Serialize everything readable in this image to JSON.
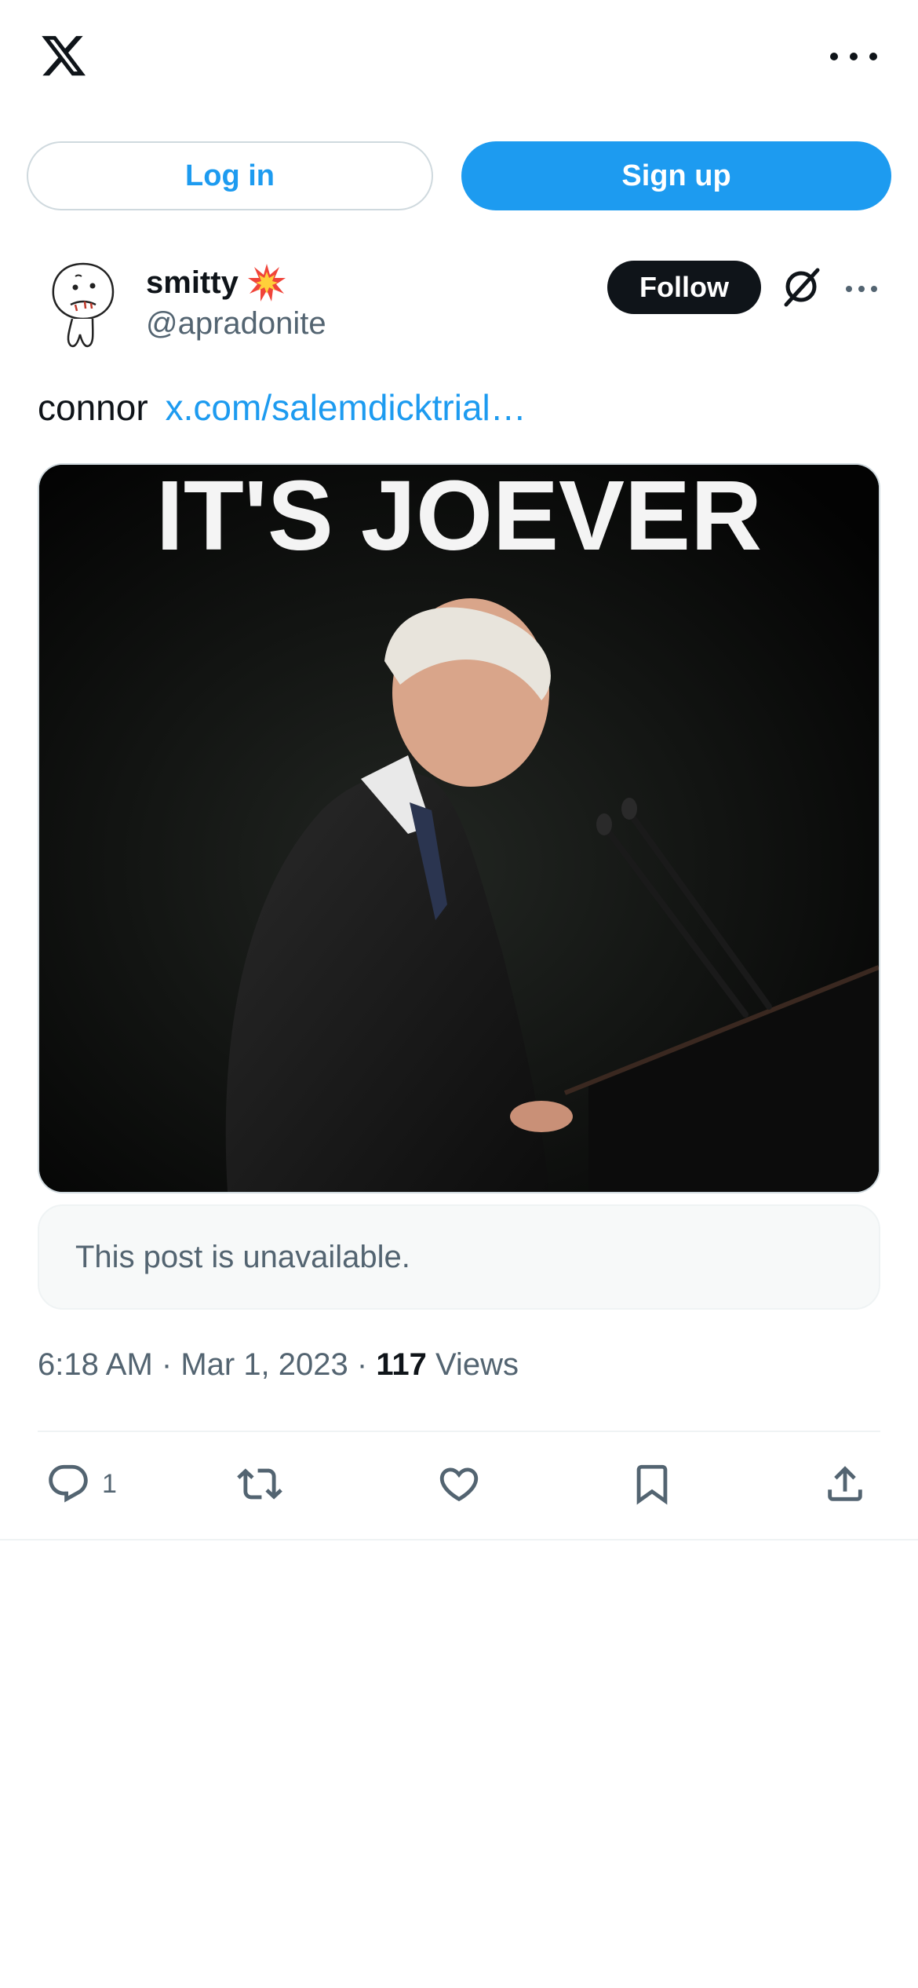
{
  "header": {
    "logo_icon": "x-logo-icon",
    "more_icon": "more-horizontal-icon"
  },
  "auth": {
    "login_label": "Log in",
    "signup_label": "Sign up"
  },
  "post": {
    "author": {
      "name": "smitty",
      "name_emoji_icon": "collision-emoji-icon",
      "handle": "@apradonite"
    },
    "follow_label": "Follow",
    "text": "connor",
    "link_text": "x.com/salemdicktrial…",
    "image": {
      "caption_text": "IT'S JOEVER"
    },
    "quoted_unavailable": "This post is unavailable.",
    "meta": {
      "time": "6:18 AM",
      "separator1": " · ",
      "date": "Mar 1, 2023",
      "separator2": " · ",
      "views_count": "117",
      "views_label": " Views"
    },
    "actions": {
      "reply_count": "1",
      "repost_count": "",
      "like_count": "",
      "bookmark_count": ""
    }
  },
  "colors": {
    "accent": "#1d9bf0",
    "text_primary": "#0f1419",
    "text_secondary": "#536471",
    "border": "#cfd9de"
  }
}
